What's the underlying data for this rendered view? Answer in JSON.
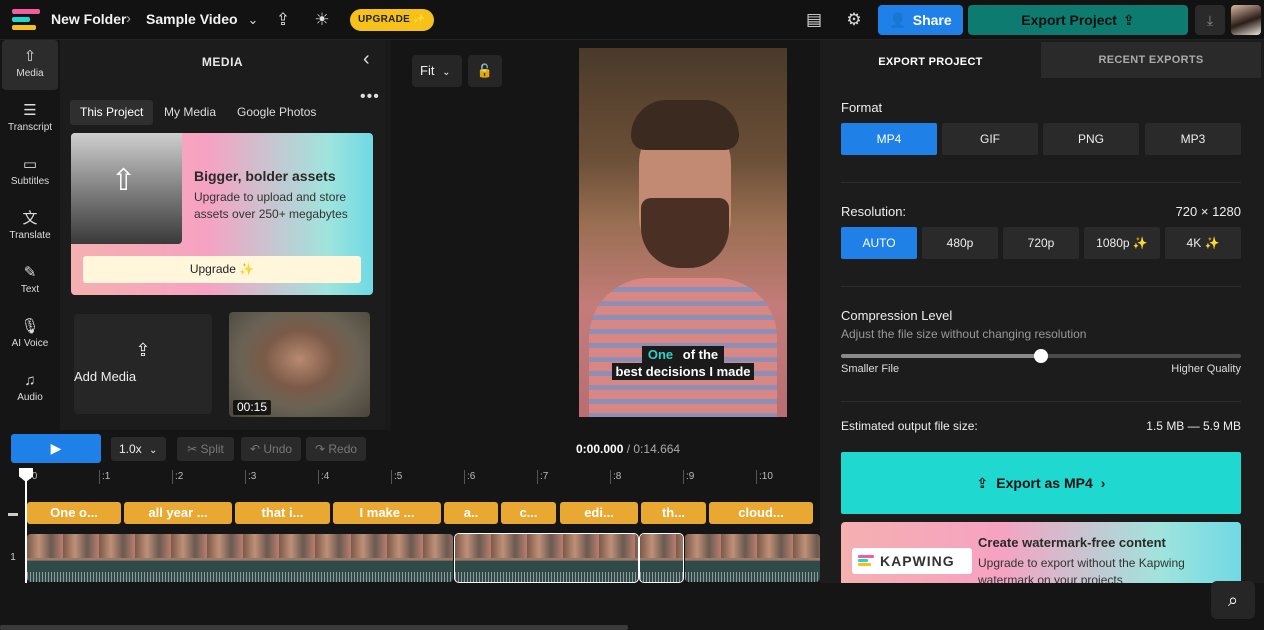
{
  "header": {
    "folder": "New Folder",
    "project": "Sample Video",
    "upgrade_label": "UPGRADE ✨",
    "share_label": "Share",
    "export_label": "Export Project"
  },
  "leftnav": [
    {
      "label": "Media",
      "icon": "upload-icon"
    },
    {
      "label": "Transcript",
      "icon": "transcript-icon"
    },
    {
      "label": "Subtitles",
      "icon": "subtitles-icon"
    },
    {
      "label": "Translate",
      "icon": "translate-icon"
    },
    {
      "label": "Text",
      "icon": "text-icon"
    },
    {
      "label": "AI Voice",
      "icon": "microphone-icon"
    },
    {
      "label": "Audio",
      "icon": "music-note-icon"
    }
  ],
  "media": {
    "title": "MEDIA",
    "tabs": [
      "This Project",
      "My Media",
      "Google Photos"
    ],
    "promo": {
      "heading": "Bigger, bolder assets",
      "body": "Upgrade to upload and store assets over 250+ megabytes",
      "button": "Upgrade ✨"
    },
    "add_media": "Add Media",
    "thumb_duration": "00:15"
  },
  "preview": {
    "fit_label": "Fit",
    "caption_highlight": "One",
    "caption_line1_rest": " of the",
    "caption_line2": "best decisions I made"
  },
  "export": {
    "tabs": [
      "EXPORT PROJECT",
      "RECENT EXPORTS"
    ],
    "format_label": "Format",
    "formats": [
      "MP4",
      "GIF",
      "PNG",
      "MP3"
    ],
    "resolution_label": "Resolution:",
    "resolution_value": "720 × 1280",
    "resolutions": [
      "AUTO",
      "480p",
      "720p",
      "1080p ✨",
      "4K ✨"
    ],
    "compression_label": "Compression Level",
    "compression_sub": "Adjust the file size without changing resolution",
    "compression_level": 0.5,
    "slider_min_label": "Smaller File",
    "slider_max_label": "Higher Quality",
    "size_label": "Estimated output file size:",
    "size_value": "1.5 MB — 5.9 MB",
    "export_button": "Export as MP4",
    "watermark": {
      "heading": "Create watermark-free content",
      "body": "Upgrade to export without the Kapwing watermark on your projects",
      "logo": "KAPWING"
    }
  },
  "timeline": {
    "speed": "1.0x",
    "split": "Split",
    "undo": "Undo",
    "redo": "Redo",
    "current_time": "0:00.000",
    "total_time": "/ 0:14.664",
    "ticks": [
      ":0",
      ":1",
      ":2",
      ":3",
      ":4",
      ":5",
      ":6",
      ":7",
      ":8",
      ":9",
      ":10"
    ],
    "subtitles": [
      "One o...",
      "all year ...",
      "that i...",
      "I make ...",
      "a..",
      "c...",
      "edi...",
      "th...",
      "cloud..."
    ],
    "video_track_label": "1"
  },
  "colors": {
    "accent_blue": "#1f80e8",
    "export_teal": "#0d7b70",
    "export_cyan": "#1fd9d0",
    "upgrade_yellow": "#f6c21a",
    "subtitle_chip": "#e8a832"
  }
}
